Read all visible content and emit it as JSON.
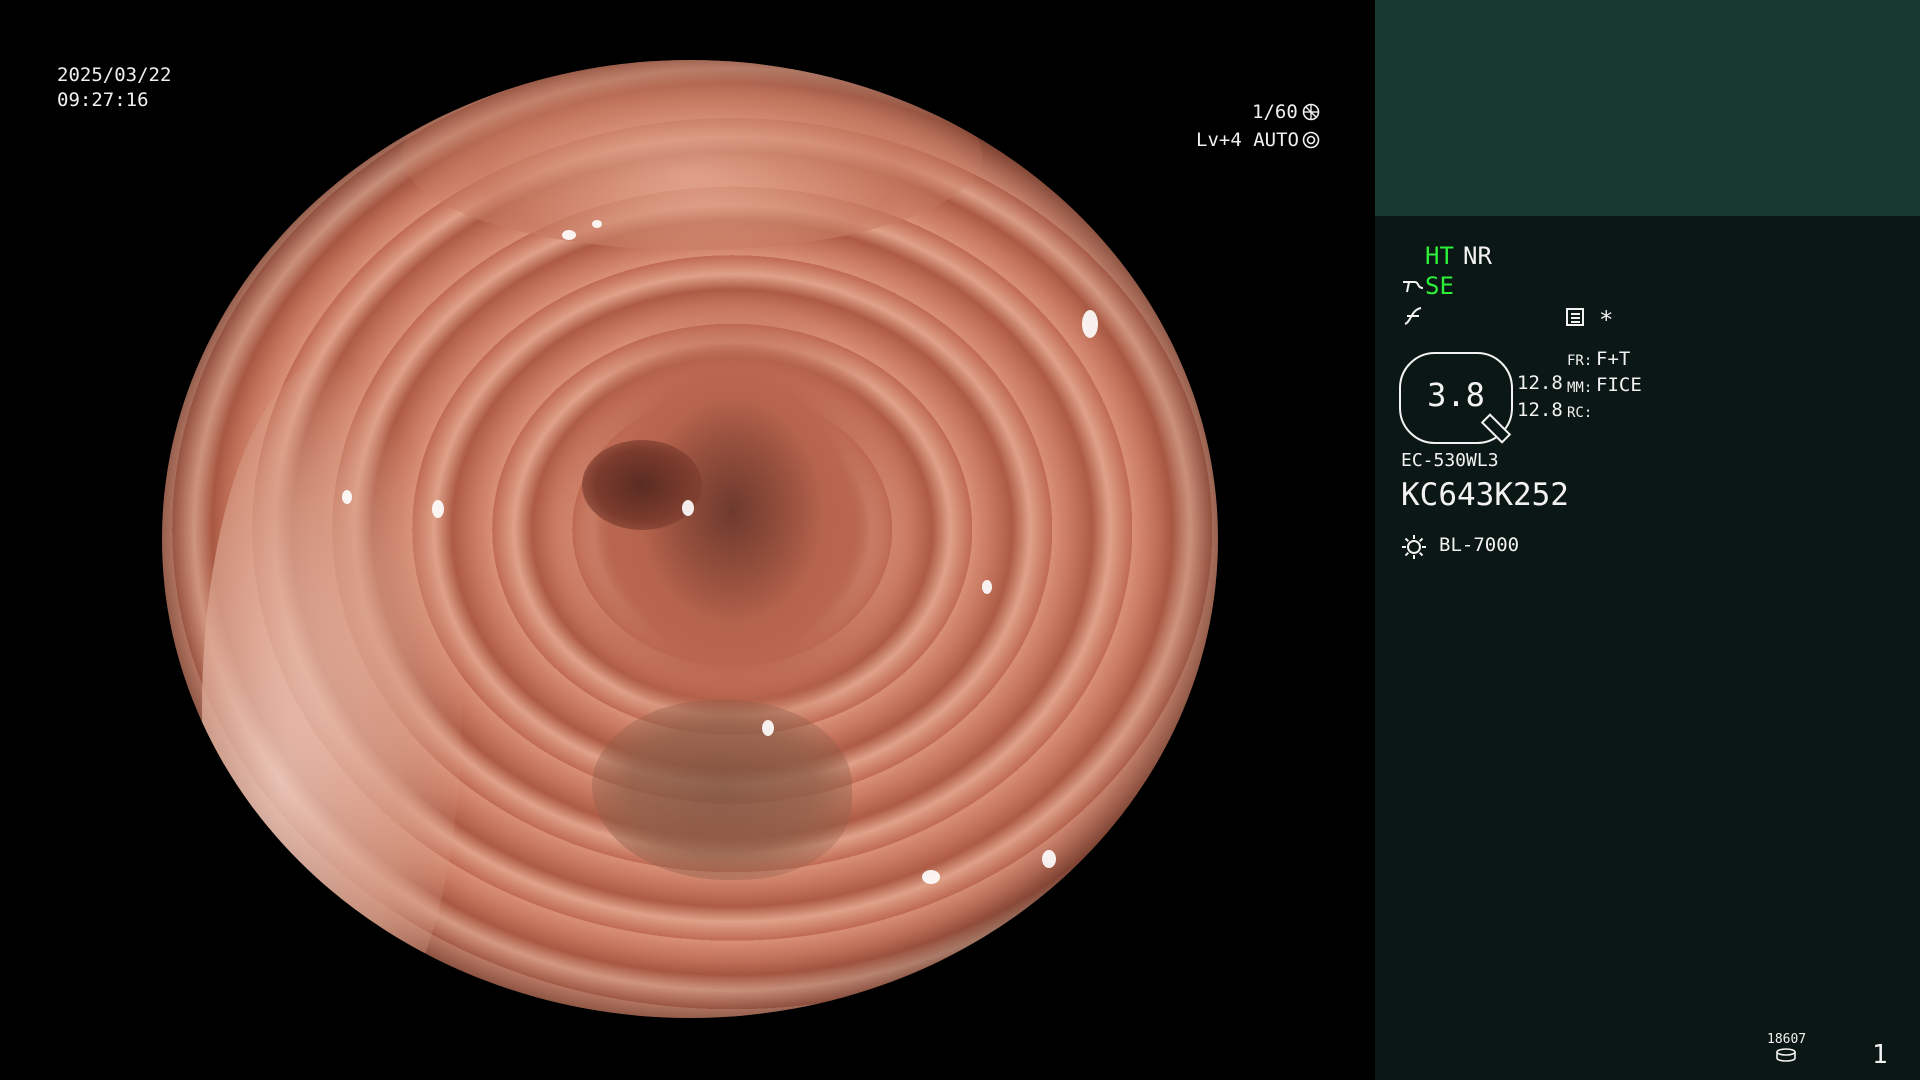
{
  "main_view": {
    "date": "2025/03/22",
    "time": "09:27:16",
    "shutter": "1/60",
    "shutter_icon": "aperture-icon",
    "exposure": "Lv+4 AUTO",
    "exposure_icon": "target-icon"
  },
  "side_panel": {
    "ht_label": "HT",
    "nr_label": "NR",
    "se_label": "SE",
    "se_icon": "enhancement-icon",
    "gamma_icon": "curve-icon",
    "menu_icon": "menu-icon",
    "asterisk": "*",
    "zoom_value": "3.8",
    "value_1": "12.8",
    "value_2": "12.8",
    "fr_label": "FR:",
    "fr_value": "F+T",
    "mm_label": "MM:",
    "mm_value": "FICE",
    "rc_label": "RC:",
    "scope_model": "EC-530WL3",
    "scope_serial": "KC643K252",
    "light_source": "BL-7000",
    "light_icon": "sun-icon",
    "storage_count": "18607",
    "storage_icon": "disk-icon",
    "page_number": "1"
  },
  "colors": {
    "panel_bg": "#0b1714",
    "panel_top": "#163a32",
    "accent_green": "#2df03b"
  }
}
